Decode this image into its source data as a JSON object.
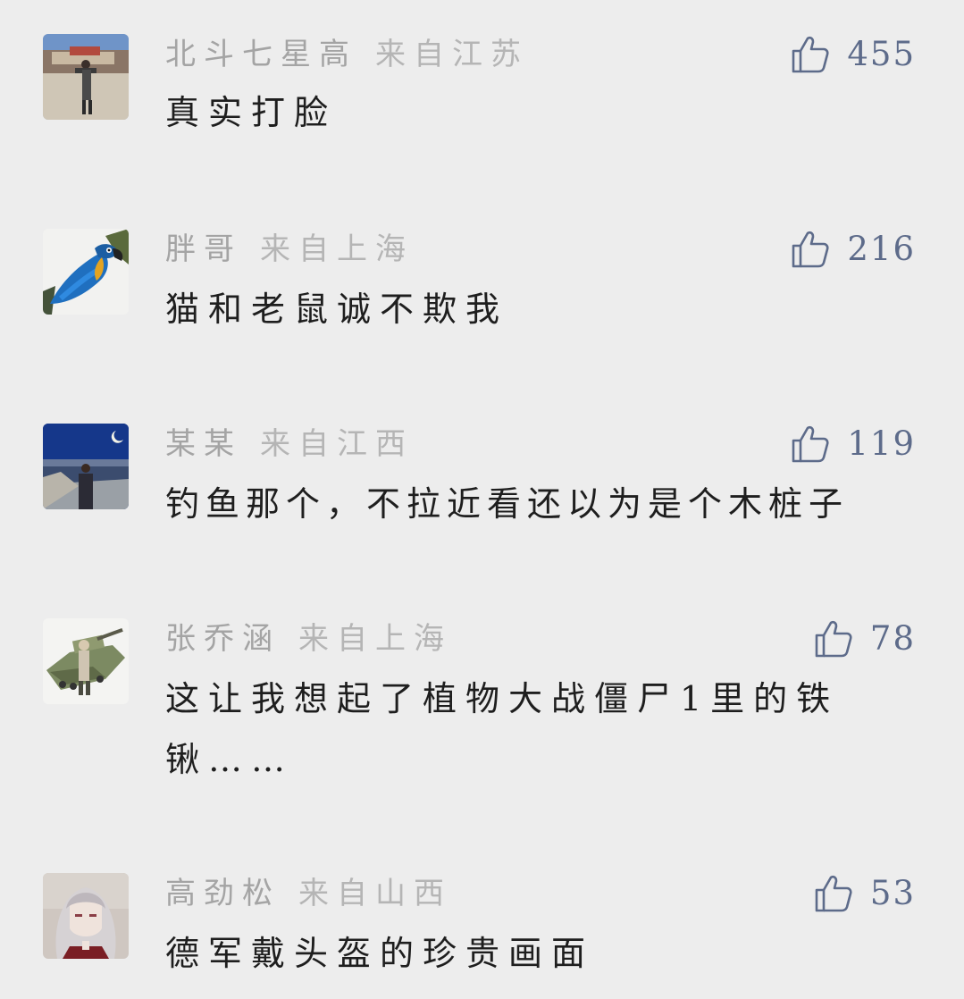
{
  "colors": {
    "background": "#ededed",
    "username": "#a4a4a4",
    "location": "#b5b5b5",
    "comment_text": "#1e1e1e",
    "like_accent": "#5d6b8a"
  },
  "comments": [
    {
      "username": "北斗七星高",
      "location": "来自江苏",
      "likes": "455",
      "text_lines": [
        "真实打脸"
      ],
      "avatar_icon": "person-at-palace-photo"
    },
    {
      "username": "胖哥",
      "location": "来自上海",
      "likes": "216",
      "text_lines": [
        "猫和老鼠诚不欺我"
      ],
      "avatar_icon": "blue-macaw-photo"
    },
    {
      "username": "某某",
      "location": "来自江西",
      "likes": "119",
      "text_lines": [
        "钓鱼那个，不拉近看还以为是个木桩子"
      ],
      "avatar_icon": "person-at-beach-night-photo"
    },
    {
      "username": "张乔涵",
      "location": "来自上海",
      "likes": "78",
      "text_lines": [
        "这让我想起了植物大战僵尸1里的铁",
        "锹……"
      ],
      "avatar_icon": "tank-model-photo"
    },
    {
      "username": "高劲松",
      "location": "来自山西",
      "likes": "53",
      "text_lines": [
        "德军戴头盔的珍贵画面"
      ],
      "avatar_icon": "anime-character-illustration"
    }
  ]
}
